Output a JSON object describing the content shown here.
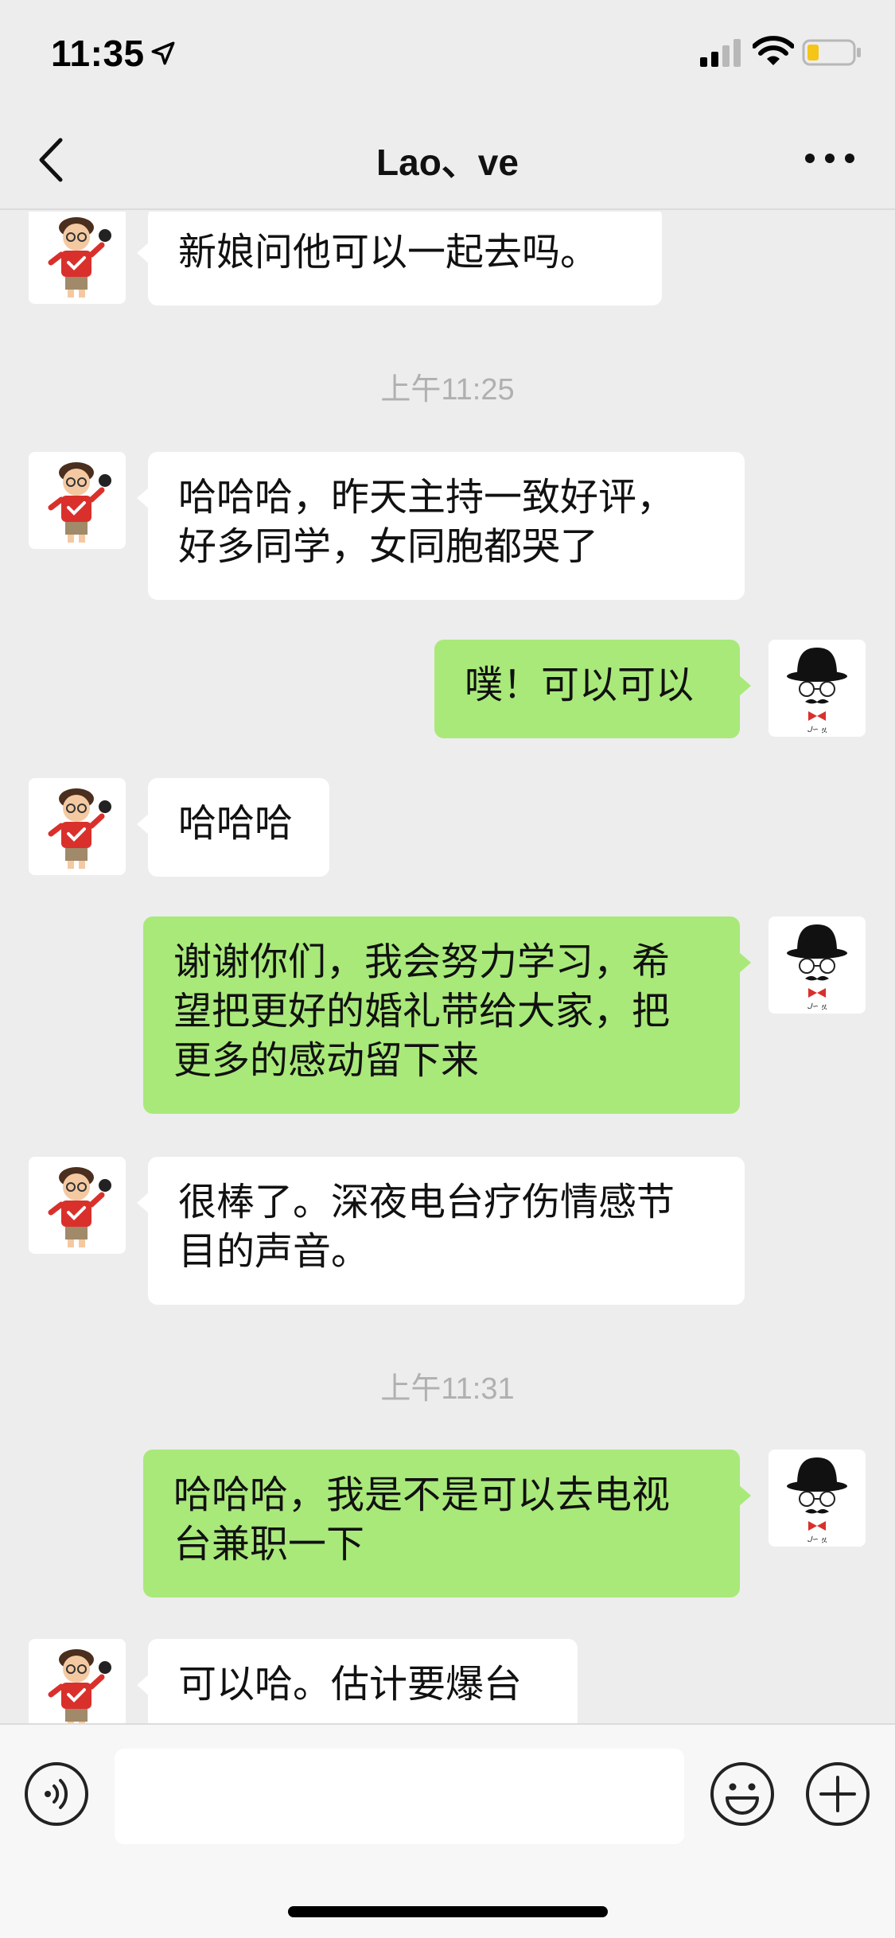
{
  "status_bar": {
    "time": "11:35",
    "location_icon": "location-arrow-icon",
    "signal_icon": "cellular-signal-icon",
    "wifi_icon": "wifi-icon",
    "battery_icon": "battery-low-icon",
    "battery_color": "#f5c518"
  },
  "nav": {
    "back_icon": "chevron-left-icon",
    "title": "Lao、ve",
    "more_icon": "more-dots-icon"
  },
  "colors": {
    "background": "#ededed",
    "incoming_bubble": "#ffffff",
    "outgoing_bubble": "#a9e97a",
    "timestamp_text": "#b0b0b0"
  },
  "messages": {
    "m1": {
      "sender": "other",
      "text": "新娘问他可以一起去吗。"
    },
    "t1": "上午11:25",
    "m2": {
      "sender": "other",
      "line1": "哈哈哈，昨天主持一致好评，",
      "line2": "好多同学，女同胞都哭了"
    },
    "m3": {
      "sender": "me",
      "text": "噗！可以可以"
    },
    "m4": {
      "sender": "other",
      "text": "哈哈哈"
    },
    "m5": {
      "sender": "me",
      "line1": "谢谢你们，我会努力学习，希",
      "line2": "望把更好的婚礼带给大家，把",
      "line3": "更多的感动留下来"
    },
    "m6": {
      "sender": "other",
      "line1": "很棒了。深夜电台疗伤情感节",
      "line2": "目的声音。"
    },
    "t2": "上午11:31",
    "m7": {
      "sender": "me",
      "line1": "哈哈哈，我是不是可以去电视",
      "line2": "台兼职一下"
    },
    "m8": {
      "sender": "other",
      "text": "可以哈。估计要爆台"
    }
  },
  "avatars": {
    "other": "cartoon-boy-avatar",
    "me": "gentleman-hat-avatar"
  },
  "input_bar": {
    "voice_icon": "voice-input-icon",
    "input_value": "",
    "emoji_icon": "emoji-smile-icon",
    "plus_icon": "plus-circle-icon"
  }
}
